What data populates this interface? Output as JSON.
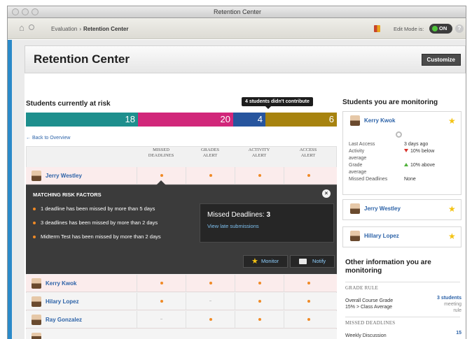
{
  "window": {
    "title": "Retention Center"
  },
  "nav": {
    "breadcrumb": {
      "parent": "Evaluation",
      "separator": "›",
      "current": "Retention Center"
    },
    "edit_mode_label": "Edit Mode is:",
    "edit_mode_value": "ON",
    "help_label": "?"
  },
  "header": {
    "title": "Retention Center",
    "customize_label": "Customize"
  },
  "risk": {
    "heading": "Students currently at risk",
    "tooltip": "4 students didn't contribute",
    "bar": [
      {
        "label": "18",
        "color": "#1e8f8d",
        "value": 18
      },
      {
        "label": "20",
        "color": "#d1277a",
        "value": 20
      },
      {
        "label": "4",
        "color": "#27559e",
        "value": 4
      },
      {
        "label": "6",
        "color": "#a7830f",
        "value": 6
      }
    ],
    "back_link": "← Back to Overview"
  },
  "table": {
    "columns": [
      {
        "line1": "MISSED",
        "line2": "DEADLINES"
      },
      {
        "line1": "GRADES",
        "line2": "ALERT"
      },
      {
        "line1": "ACTIVITY",
        "line2": "ALERT"
      },
      {
        "line1": "ACCESS",
        "line2": "ALERT"
      }
    ],
    "rows": [
      {
        "name": "Jerry Westley",
        "alerts": [
          true,
          true,
          true,
          true
        ]
      },
      {
        "name": "Kerry Kwok",
        "alerts": [
          true,
          true,
          true,
          true
        ]
      },
      {
        "name": "Hilary Lopez",
        "alerts": [
          true,
          false,
          true,
          true
        ]
      },
      {
        "name": "Ray Gonzalez",
        "alerts": [
          false,
          true,
          true,
          true
        ]
      }
    ]
  },
  "panel": {
    "title": "MATCHING RISK FACTORS",
    "close_label": "×",
    "factors": [
      "1 deadline has been missed by more than 5 days",
      "3 deadlines has been missed by more than 2 days",
      "Midterm Test has been missed by more than 2 days"
    ],
    "missed_label": "Missed Deadlines:",
    "missed_count": "3",
    "late_link": "View late submissions",
    "monitor_label": "Monitor",
    "notify_label": "Notify"
  },
  "monitoring": {
    "heading": "Students you are monitoring",
    "featured": {
      "name": "Kerry Kwok",
      "stats": [
        {
          "label": "Last Access",
          "value": "3 days ago",
          "trend": ""
        },
        {
          "label": "Activity",
          "value": "10% below",
          "trend": "down"
        },
        {
          "label": "average",
          "value": "",
          "trend": ""
        },
        {
          "label": "Grade",
          "value": "10% above",
          "trend": "up"
        },
        {
          "label": "average",
          "value": "",
          "trend": ""
        },
        {
          "label": "Missed Deadlines",
          "value": "None",
          "trend": ""
        }
      ]
    },
    "students": [
      {
        "name": "Jerry Westley"
      },
      {
        "name": "Hillary Lopez"
      }
    ]
  },
  "other_info": {
    "heading": "Other information you are monitoring",
    "grade_rule": {
      "section": "GRADE RULE",
      "label1": "Overall Course Grade",
      "label2": "15% > Class Average",
      "value": "3 students",
      "sub1": "meeting",
      "sub2": "rule"
    },
    "missed": {
      "section": "MISSED DEADLINES",
      "label": "Weekly Discussion",
      "value": "15"
    }
  },
  "colors": {
    "accent_blue": "#2d63a8",
    "alert_orange": "#f08a26",
    "monitor_star": "#f4c313",
    "edit_on_green": "#4fc43a"
  }
}
